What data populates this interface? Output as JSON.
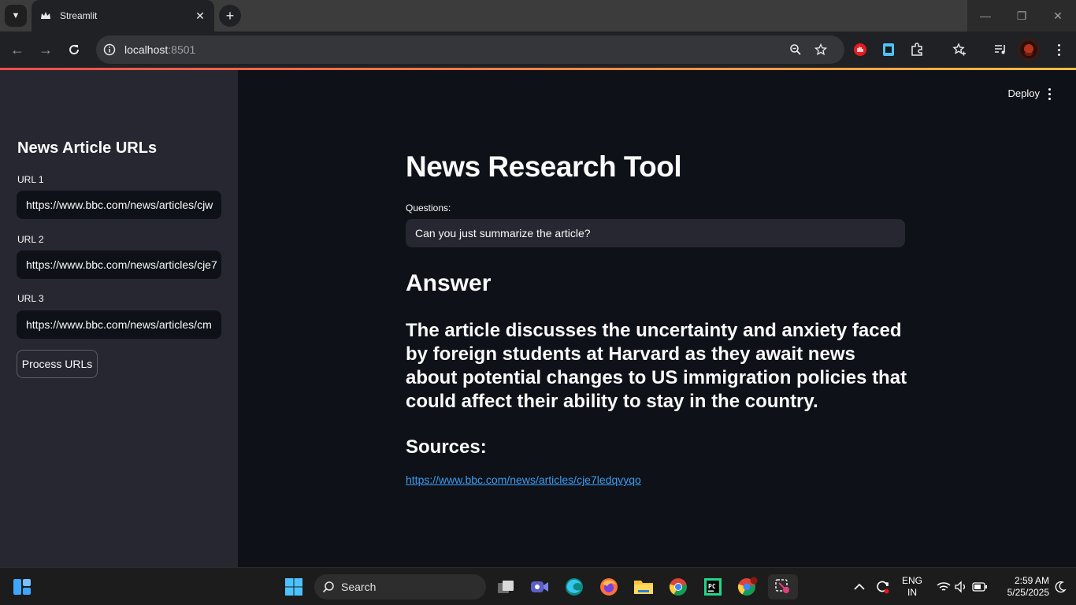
{
  "browser": {
    "tab_title": "Streamlit",
    "url_host": "localhost",
    "url_port": ":8501"
  },
  "app": {
    "deploy_label": "Deploy",
    "sidebar": {
      "heading": "News Article URLs",
      "inputs": [
        {
          "label": "URL 1",
          "value": "https://www.bbc.com/news/articles/cjw"
        },
        {
          "label": "URL 2",
          "value": "https://www.bbc.com/news/articles/cje7"
        },
        {
          "label": "URL 3",
          "value": "https://www.bbc.com/news/articles/cm"
        }
      ],
      "process_button": "Process URLs"
    },
    "main": {
      "title": "News Research Tool",
      "question_label": "Questions:",
      "question_value": "Can you just summarize the article?",
      "answer_heading": "Answer",
      "answer_text": "The article discusses the uncertainty and anxiety faced by foreign students at Harvard as they await news about potential changes to US immigration policies that could affect their ability to stay in the country.",
      "sources_heading": "Sources:",
      "source_link": "https://www.bbc.com/news/articles/cje7ledqvyqo"
    }
  },
  "taskbar": {
    "search_label": "Search",
    "language": "ENG",
    "region": "IN",
    "time": "2:59 AM",
    "date": "5/25/2025"
  },
  "colors": {
    "app_bg": "#0e1117",
    "sidebar_bg": "#262730",
    "link": "#3d9df3",
    "accent_start": "#ff4b4b",
    "accent_end": "#ffbd45"
  }
}
